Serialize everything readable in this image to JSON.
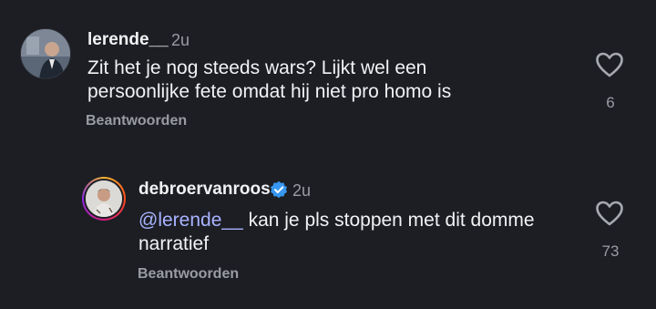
{
  "comments": [
    {
      "username": "lerende__",
      "time": "2u",
      "text": "Zit het je nog steeds wars? Lijkt wel een persoonlijke fete omdat hij niet pro homo is",
      "reply_label": "Beantwoorden",
      "likes": "6",
      "icon": "heart-outline-icon"
    },
    {
      "username": "debroervanroos",
      "verified": true,
      "time": "2u",
      "mention": "@lerende__",
      "text": " kan je pls stoppen met dit domme narratief",
      "reply_label": "Beantwoorden",
      "likes": "73",
      "icon": "heart-outline-icon"
    }
  ],
  "colors": {
    "background": "#1c1e24",
    "mention": "#a9b3ff",
    "secondary": "#9a9ca3",
    "verified": "#3897f0"
  }
}
